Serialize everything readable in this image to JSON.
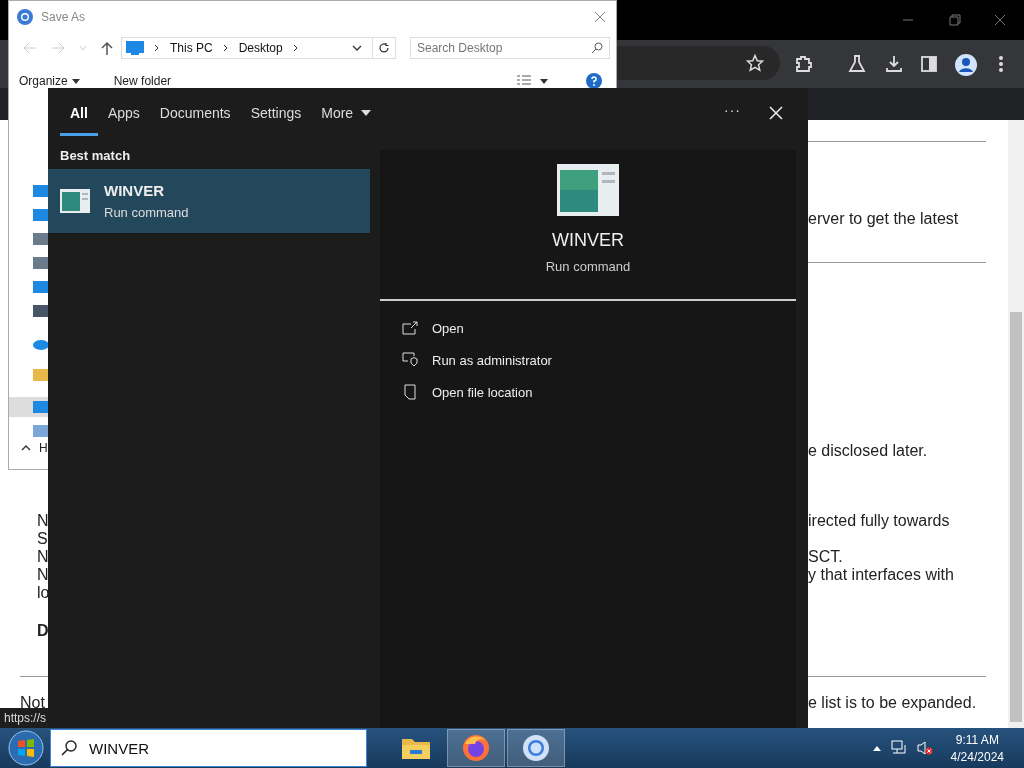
{
  "browser": {
    "content": {
      "left_fragments": [
        {
          "text": "N",
          "kind": "plain"
        },
        {
          "text": "S",
          "kind": "plain"
        },
        {
          "text": "N",
          "kind": "plain"
        },
        {
          "text": "N",
          "kind": "plain"
        },
        {
          "text": "lo",
          "kind": "plain"
        },
        {
          "text": "D",
          "kind": "heading"
        },
        {
          "text": "Not",
          "kind": "note"
        }
      ],
      "right_fragments": [
        "erver to get the latest",
        "e disclosed later.",
        "irected fully towards",
        "SCT.",
        "y that interfaces with",
        "e list is to be expanded."
      ]
    },
    "status_url": "https://s"
  },
  "save_as_dialog": {
    "title": "Save As",
    "breadcrumb": [
      "This PC",
      "Desktop"
    ],
    "search": {
      "placeholder": "Search Desktop"
    },
    "organize": "Organize",
    "new_folder": "New folder",
    "nav_items": [
      {
        "kind": "desktop",
        "selected": false
      },
      {
        "kind": "download",
        "selected": false
      },
      {
        "kind": "document",
        "selected": false
      },
      {
        "kind": "picture",
        "selected": false
      },
      {
        "kind": "music",
        "selected": false
      },
      {
        "kind": "video",
        "selected": false
      },
      {
        "kind": "cloud",
        "selected": false
      },
      {
        "kind": "folder",
        "selected": false
      },
      {
        "kind": "pc",
        "selected": true
      },
      {
        "kind": "network",
        "selected": false
      }
    ],
    "hide_folders": "H"
  },
  "search_panel": {
    "tabs": [
      {
        "label": "All",
        "selected": true
      },
      {
        "label": "Apps",
        "selected": false
      },
      {
        "label": "Documents",
        "selected": false
      },
      {
        "label": "Settings",
        "selected": false
      },
      {
        "label": "More",
        "selected": false,
        "dropdown": true
      }
    ],
    "more_icon": "···",
    "best_match_heading": "Best match",
    "results": [
      {
        "name": "WINVER",
        "type": "Run command",
        "selected": true
      }
    ],
    "preview": {
      "name": "WINVER",
      "type": "Run command"
    },
    "actions": [
      {
        "label": "Open",
        "kind": "open"
      },
      {
        "label": "Run as administrator",
        "kind": "admin"
      },
      {
        "label": "Open file location",
        "kind": "location"
      }
    ]
  },
  "taskbar": {
    "search": {
      "value": "WINVER"
    },
    "apps": [
      {
        "kind": "folder",
        "running": false
      },
      {
        "kind": "firefox",
        "running": true
      },
      {
        "kind": "chrome",
        "running": true
      }
    ],
    "clock": {
      "time": "9:11 AM",
      "date": "4/24/2024"
    }
  }
}
